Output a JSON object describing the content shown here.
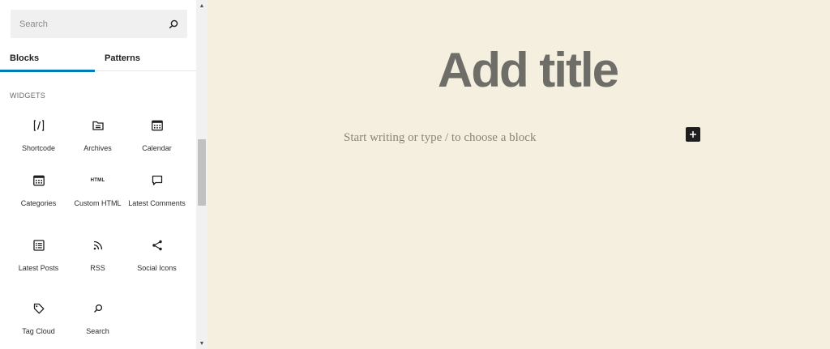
{
  "sidebar": {
    "search": {
      "placeholder": "Search",
      "value": ""
    },
    "tabs": [
      {
        "label": "Blocks",
        "active": true
      },
      {
        "label": "Patterns",
        "active": false
      }
    ],
    "category": "WIDGETS",
    "blocks": [
      {
        "label": "Shortcode",
        "icon": "shortcode-icon"
      },
      {
        "label": "Archives",
        "icon": "archives-icon"
      },
      {
        "label": "Calendar",
        "icon": "calendar-icon"
      },
      {
        "label": "Categories",
        "icon": "categories-icon"
      },
      {
        "label": "Custom HTML",
        "icon": "html-icon",
        "icon_text": "HTML"
      },
      {
        "label": "Latest Comments",
        "icon": "comment-icon"
      },
      {
        "label": "Latest Posts",
        "icon": "list-icon"
      },
      {
        "label": "RSS",
        "icon": "rss-icon"
      },
      {
        "label": "Social Icons",
        "icon": "share-icon"
      },
      {
        "label": "Tag Cloud",
        "icon": "tag-icon"
      },
      {
        "label": "Search",
        "icon": "search-icon"
      }
    ]
  },
  "editor": {
    "title_placeholder": "Add title",
    "block_placeholder": "Start writing or type / to choose a block"
  },
  "colors": {
    "accent": "#007cba",
    "canvas": "#f5efe0",
    "sidebar": "#ffffff",
    "title": "#6f6d68"
  }
}
